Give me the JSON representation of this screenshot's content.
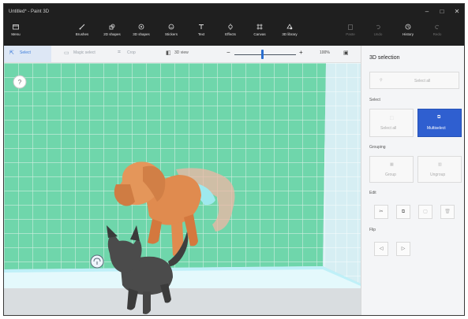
{
  "window": {
    "title": "Untitled* - Paint 3D",
    "controls": {
      "minimize": "–",
      "maximize": "□",
      "close": "✕"
    }
  },
  "ribbon": {
    "menu": "Menu",
    "tools": [
      "Brushes",
      "2D shapes",
      "3D shapes",
      "Stickers",
      "Text",
      "Effects",
      "Canvas",
      "3D library"
    ],
    "right": [
      "Paste",
      "Undo",
      "History",
      "Redo"
    ]
  },
  "toolbar": {
    "select": "Select",
    "magic_select": "Magic select",
    "crop": "Crop",
    "view_mode": "3D view",
    "zoom_value": "100%",
    "zoom_level": 0.45
  },
  "canvas": {
    "help_label": "?",
    "bg_color": "#6fd6ab",
    "grid_color": "#cfeee0",
    "dog_color": "#e08b4f",
    "cat_color": "#4b4b4b"
  },
  "panel": {
    "title": "3D selection",
    "select_all": "Select all",
    "select_section": "Select",
    "select_options": [
      "Select all",
      "Multiselect"
    ],
    "grouping_section": "Grouping",
    "grouping_options": [
      "Group",
      "Ungroup"
    ],
    "edit_section": "Edit",
    "flip_section": "Flip",
    "accent": "#2f5fd0"
  }
}
